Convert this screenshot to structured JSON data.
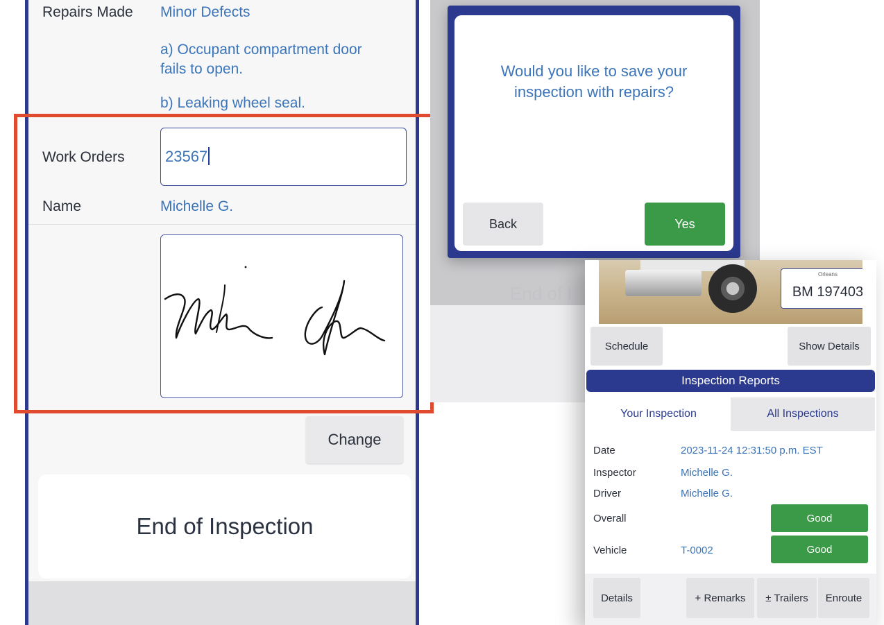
{
  "inspection_form": {
    "repairs_made_label": "Repairs Made",
    "repairs_made_value": "Minor Defects",
    "defect_a": "a) Occupant compartment door fails to open.",
    "defect_b": "b) Leaking wheel seal.",
    "work_orders_label": "Work Orders",
    "work_orders_value": "23567",
    "name_label": "Name",
    "name_value": "Michelle G.",
    "change_button": "Change",
    "end_of_inspection": "End of Inspection"
  },
  "save_dialog": {
    "message": "Would you like to save your inspection with repairs?",
    "back_button": "Back",
    "yes_button": "Yes",
    "background_text": "End of I"
  },
  "report": {
    "plate_label": "Orleans",
    "plate_number": "BM 197403",
    "schedule_button": "Schedule",
    "show_details_button": "Show Details",
    "section_title": "Inspection Reports",
    "tabs": [
      {
        "label": "Your Inspection",
        "active": true
      },
      {
        "label": "All Inspections",
        "active": false
      }
    ],
    "fields": {
      "date_label": "Date",
      "date_value": "2023-11-24 12:31:50 p.m. EST",
      "inspector_label": "Inspector",
      "inspector_value": "Michelle G.",
      "driver_label": "Driver",
      "driver_value": "Michelle G.",
      "overall_label": "Overall",
      "overall_status": "Good",
      "vehicle_label": "Vehicle",
      "vehicle_value": "T-0002",
      "vehicle_status": "Good"
    },
    "actions": {
      "details": "Details",
      "remarks": "+ Remarks",
      "trailers": "± Trailers",
      "enroute": "Enroute"
    }
  },
  "colors": {
    "brand_navy": "#2b3a8f",
    "link_blue": "#3b74b8",
    "success_green": "#3b9a48",
    "highlight_red": "#e04a2e"
  }
}
